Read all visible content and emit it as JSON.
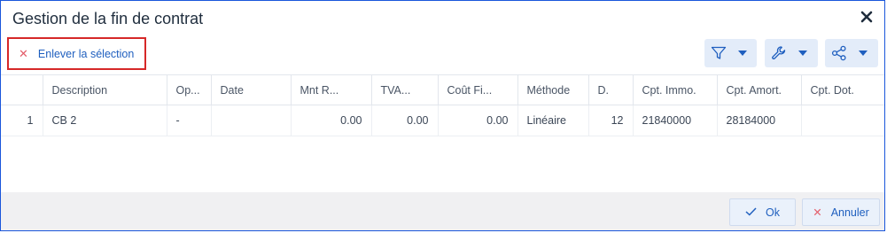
{
  "dialog": {
    "title": "Gestion de la fin de contrat"
  },
  "toolbar": {
    "remove_selection_label": "Enlever la sélection",
    "filter_icon": "funnel-icon",
    "settings_icon": "wrench-icon",
    "share_icon": "share-icon"
  },
  "table": {
    "headers": [
      "",
      "Description",
      "Op...",
      "Date",
      "Mnt R...",
      "TVA...",
      "Coût Fi...",
      "Méthode",
      "D.",
      "Cpt. Immo.",
      "Cpt. Amort.",
      "Cpt. Dot."
    ],
    "rows": [
      [
        "1",
        "CB 2",
        "-",
        "",
        "0.00",
        "0.00",
        "0.00",
        "Linéaire",
        "12",
        "21840000",
        "28184000",
        ""
      ]
    ]
  },
  "footer": {
    "ok_label": "Ok",
    "cancel_label": "Annuler"
  },
  "colors": {
    "accent": "#1f5fbf",
    "highlight_border": "#d62828",
    "dialog_border": "#1a56db"
  }
}
